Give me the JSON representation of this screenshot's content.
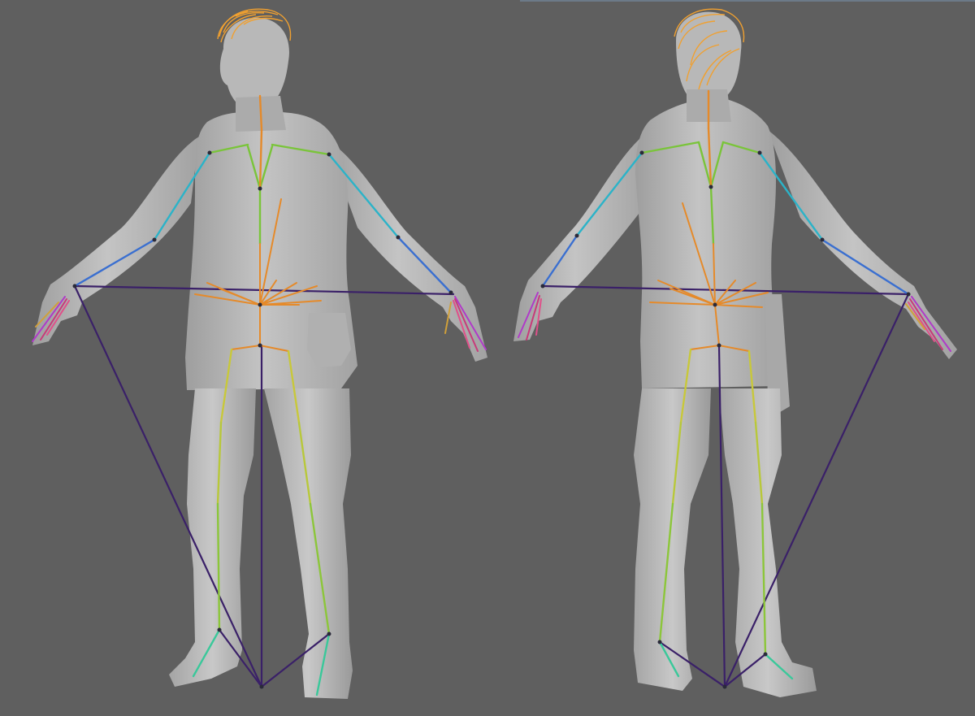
{
  "viewport": {
    "background": "#5f5f5f",
    "model_color": "#b9b9b9",
    "views": [
      "front",
      "back"
    ]
  },
  "colors": {
    "hair": "#f0a030",
    "spine_green": "#7ac43a",
    "arm_cyan": "#2bb3c8",
    "arm_blue": "#3a6fd0",
    "hip_orange": "#e58a2a",
    "leg_yellow": "#c8c83a",
    "leg_green": "#8cc63a",
    "foot_teal": "#3ac89a",
    "ik_purple": "#3a2068",
    "hand_magenta": "#b03ac8"
  }
}
